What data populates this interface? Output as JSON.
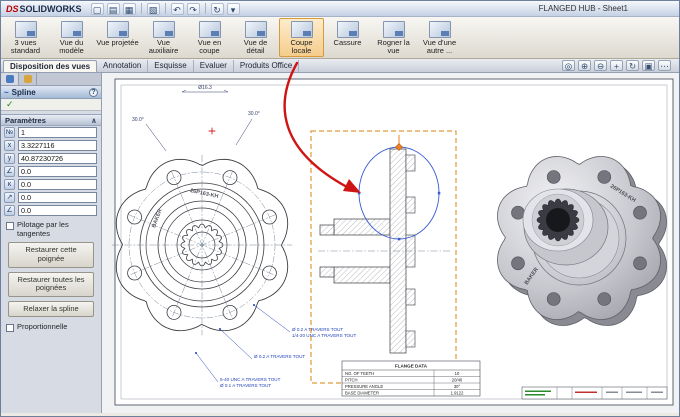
{
  "titlebar": {
    "brand_ds": "DS",
    "brand_name": "SOLIDWORKS",
    "title": "FLANGED HUB - Sheet1",
    "icons": [
      {
        "name": "new-document-icon",
        "glyph": "▢"
      },
      {
        "name": "open-folder-icon",
        "glyph": "▤"
      },
      {
        "name": "save-icon",
        "glyph": "▦"
      },
      {
        "name": "print-icon",
        "glyph": "▧"
      },
      {
        "name": "undo-icon",
        "glyph": "↶"
      },
      {
        "name": "redo-icon",
        "glyph": "↷"
      },
      {
        "name": "rebuild-icon",
        "glyph": "↻"
      },
      {
        "name": "options-dropdown-icon",
        "glyph": "▾"
      }
    ]
  },
  "toolbar": {
    "buttons": [
      {
        "label": "3 vues standard"
      },
      {
        "label": "Vue du modèle"
      },
      {
        "label": "Vue projetée"
      },
      {
        "label": "Vue auxiliaire"
      },
      {
        "label": "Vue en coupe"
      },
      {
        "label": "Vue de détail"
      },
      {
        "label": "Coupe locale",
        "active": true
      },
      {
        "label": "Cassure"
      },
      {
        "label": "Rogner la vue"
      },
      {
        "label": "Vue d'une autre ..."
      }
    ]
  },
  "tabs": [
    {
      "label": "Disposition des vues",
      "active": true
    },
    {
      "label": "Annotation"
    },
    {
      "label": "Esquisse"
    },
    {
      "label": "Evaluer"
    },
    {
      "label": "Produits Office"
    }
  ],
  "viewtools": [
    {
      "name": "zoom-fit-icon",
      "glyph": "◎"
    },
    {
      "name": "zoom-in-icon",
      "glyph": "⊕"
    },
    {
      "name": "zoom-out-icon",
      "glyph": "⊖"
    },
    {
      "name": "pan-icon",
      "glyph": "+"
    },
    {
      "name": "rotate-view-icon",
      "glyph": "↻"
    },
    {
      "name": "display-style-icon",
      "glyph": "▣"
    },
    {
      "name": "more-view-tools-icon",
      "glyph": "⋯"
    }
  ],
  "panel": {
    "title": "Spline",
    "spline_glyph": "~",
    "help": "?",
    "check": "✓",
    "section": "Paramètres",
    "collapse": "∧",
    "rows": [
      {
        "icon": "№",
        "value": "1"
      },
      {
        "icon": "x",
        "value": "3.3227116"
      },
      {
        "icon": "y",
        "value": "40.87230726"
      },
      {
        "icon": "∠",
        "value": "0.0"
      },
      {
        "icon": "κ",
        "value": "0.0"
      },
      {
        "icon": "↗",
        "value": "0.0"
      },
      {
        "icon": "∠",
        "value": "0.0"
      }
    ],
    "tangent_label": "Pilotage par les tangentes",
    "buttons": [
      "Restaurer cette poignée",
      "Restaurer toutes les poignées",
      "Relaxer la spline"
    ],
    "proportional_label": "Proportionnelle"
  },
  "drawing": {
    "front_dim_diameter": "Ø16.3",
    "front_angle_1": "30.0°",
    "front_angle_2": "30.0°",
    "marking_brand": "BAKER",
    "marking_part": "26P163-KH",
    "notes": [
      {
        "l1": "Ø 0.2 A TRAVERS TOUT",
        "l2": "1/4-20 UNC  A TRAVERS TOUT"
      },
      {
        "l1": "Ø 0.2 A TRAVERS TOUT"
      },
      {
        "l1": "5-40 UNC  A TRAVERS TOUT",
        "l2": "Ø 0.1 A TRAVERS TOUT"
      }
    ],
    "table": {
      "title": "FLANGE DATA",
      "rows": [
        [
          "NO. OF TEETH",
          "10"
        ],
        [
          "PITCH",
          "20/40"
        ],
        [
          "PRESSURE ANGLE",
          "30°"
        ],
        [
          "BASE DIAMETER",
          "1.9122"
        ]
      ]
    }
  }
}
